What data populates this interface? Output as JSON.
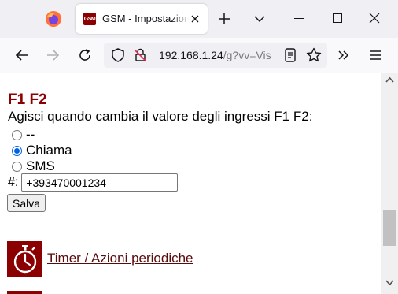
{
  "browser": {
    "tab": {
      "title": "GSM - Impostazioni",
      "favicon_text": "GSM"
    },
    "url": {
      "host": "192.168.1.24",
      "path": "/g?vv=Vis"
    }
  },
  "page": {
    "section_title": "F1 F2",
    "question": "Agisci quando cambia il valore degli ingressi F1 F2:",
    "options": [
      {
        "label": "--",
        "checked": false
      },
      {
        "label": "Chiama",
        "checked": true
      },
      {
        "label": "SMS",
        "checked": false
      }
    ],
    "phone_label": "#:",
    "phone_value": "+393470001234",
    "save_label": "Salva",
    "timer_link": "Timer / Azioni periodiche"
  },
  "colors": {
    "brand": "#8b0000",
    "link": "#5a0a0a",
    "radio_accent": "#0060df"
  }
}
